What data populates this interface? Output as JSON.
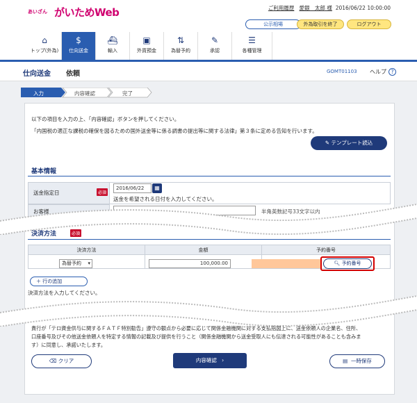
{
  "header": {
    "logo_small": "あいざん",
    "logo_main": "がいためWeb",
    "usage_history": "ご利用履歴",
    "user_name": "愛銀　太郎 様",
    "datetime": "2016/06/22 10:00:00",
    "btn_rates": "公示相場",
    "btn_end_fx": "外為取引を終了",
    "btn_logout": "ログアウト"
  },
  "nav": [
    {
      "label": "トップ(外為)",
      "icon": "home-icon"
    },
    {
      "label": "仕向送金",
      "icon": "remittance-icon",
      "active": true
    },
    {
      "label": "輸入",
      "icon": "import-icon"
    },
    {
      "label": "外貨預金",
      "icon": "deposit-icon"
    },
    {
      "label": "為替予約",
      "icon": "exchange-icon"
    },
    {
      "label": "承認",
      "icon": "approve-icon"
    },
    {
      "label": "各種管理",
      "icon": "manage-icon"
    }
  ],
  "page": {
    "title": "仕向送金",
    "subtitle": "依頼",
    "screen_id": "GOMT01103",
    "help": "ヘルプ"
  },
  "steps": [
    "入力",
    "内容確認",
    "完了"
  ],
  "intro": {
    "line1": "以下の項目を入力の上、「内容確認」ボタンを押してください。",
    "line2": "「内国税の適正な課税の確保を図るための国外送金等に係る調書の提出等に関する法律」第３条に定める告知を行います。",
    "template_btn": "テンプレート読込"
  },
  "basic_info": {
    "title": "基本情報",
    "remit_date_label": "送金指定日",
    "required": "必須",
    "remit_date_value": "2016/06/22",
    "remit_date_hint": "送金を希望される日付を入力してください。",
    "second_label": "お客様",
    "second_hint": "半角英数記号33文字以内"
  },
  "settlement": {
    "title": "決済方法",
    "required": "必須",
    "col_method": "決済方法",
    "col_amount": "金額",
    "col_contract": "予約番号",
    "method_value": "為替予約",
    "amount_value": "100,000.00",
    "contract_btn": "予約番号",
    "add_row": "行の追加",
    "hint": "決済方法を入力してください。"
  },
  "footer": {
    "notice_line1": "貴行が「テロ資金供与に関するＦＡＴＦ特別勧告」遵守の観点から必要に応じて関係金融機関に対する支払指図上に、送金依頼人の企業名、住所、",
    "notice_line2": "口座番号及びその他送金依頼人を特定する情報の記載及び提供を行うこと（関係金融機関から送金受取人にも伝達される可能性があることも含みま",
    "notice_line3": "す）に同意し、承諾いたします。",
    "clear_btn": "クリア",
    "confirm_btn": "内容確認",
    "save_btn": "一時保存"
  },
  "colors": {
    "navy": "#1f3a7a",
    "blue": "#2a5db0",
    "pink": "#d0006f",
    "highlight_red": "#d40000",
    "orange_field": "#ffc79a"
  }
}
